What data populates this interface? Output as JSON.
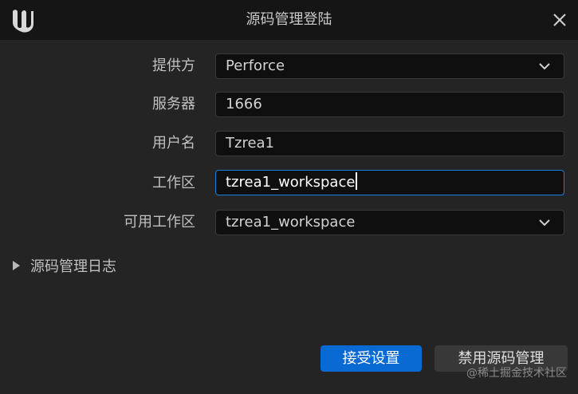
{
  "dialog": {
    "title": "源码管理登陆",
    "close_icon": "close-icon",
    "logo_icon": "unreal-logo-icon"
  },
  "form": {
    "provider": {
      "label": "提供方",
      "value": "Perforce"
    },
    "server": {
      "label": "服务器",
      "value": "1666"
    },
    "username": {
      "label": "用户名",
      "value": "Tzrea1"
    },
    "workspace": {
      "label": "工作区",
      "value": "tzrea1_workspace"
    },
    "available_workspaces": {
      "label": "可用工作区",
      "value": "tzrea1_workspace"
    }
  },
  "log": {
    "label": "源码管理日志"
  },
  "buttons": {
    "accept": "接受设置",
    "disable": "禁用源码管理"
  },
  "watermark": "@稀土掘金技术社区",
  "colors": {
    "accent": "#0a6ad4",
    "focus_border": "#1c7fe0",
    "background": "#242424",
    "titlebar": "#151515"
  }
}
